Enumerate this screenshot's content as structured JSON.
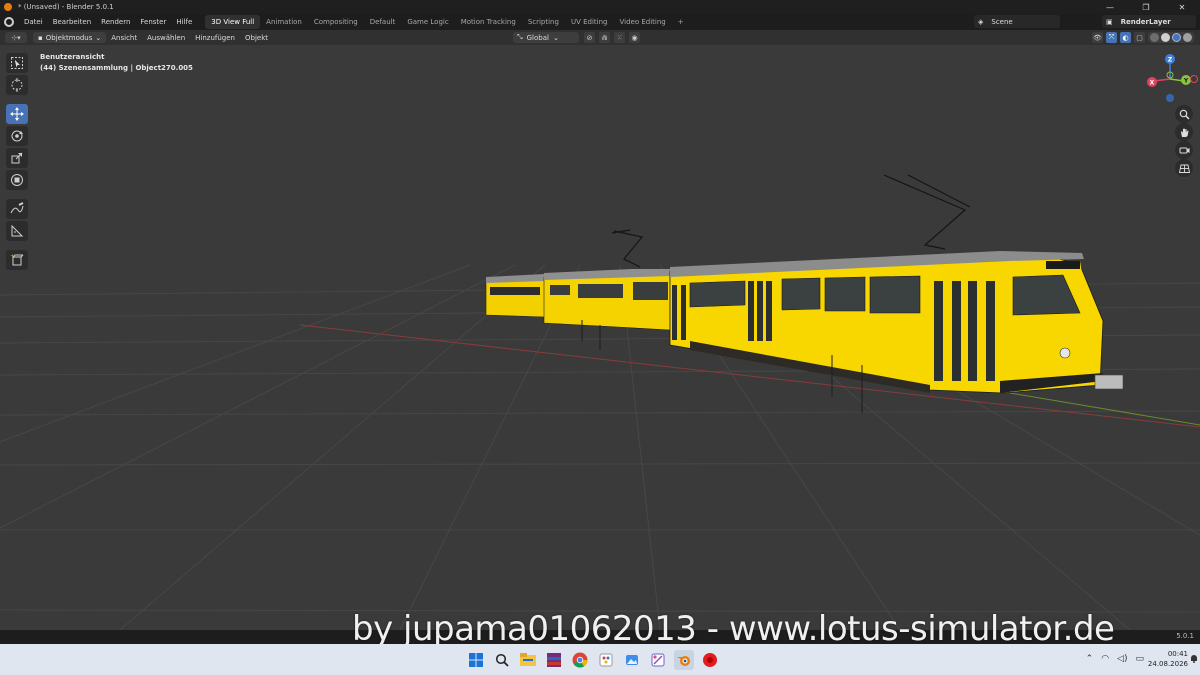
{
  "titlebar": {
    "title": "* (Unsaved) - Blender 5.0.1",
    "min": "—",
    "max": "❐",
    "close": "✕"
  },
  "menu": {
    "items": [
      "Datei",
      "Bearbeiten",
      "Rendern",
      "Fenster",
      "Hilfe"
    ]
  },
  "workspaces": {
    "tabs": [
      "3D View Full",
      "Animation",
      "Compositing",
      "Default",
      "Game Logic",
      "Motion Tracking",
      "Scripting",
      "UV Editing",
      "Video Editing"
    ],
    "active": "3D View Full",
    "add": "+"
  },
  "scene": {
    "label": "Scene"
  },
  "viewlayer": {
    "label": "RenderLayer"
  },
  "viewport_header": {
    "mode": "Objektmodus",
    "menus": [
      "Ansicht",
      "Auswählen",
      "Hinzufügen",
      "Objekt"
    ],
    "orientation": "Global"
  },
  "viewport": {
    "view_name": "Benutzeransicht",
    "collection_info": "(44) Szenensammlung | Object270.005"
  },
  "gizmo": {
    "axes": [
      "X",
      "Y",
      "Z"
    ],
    "colors": {
      "x": "#e0445c",
      "y": "#8ac43c",
      "z": "#3f7fd6",
      "neg": "#3666a8"
    }
  },
  "colors": {
    "accent": "#4772b3",
    "tram_yellow": "#f7d500",
    "viewport_bg": "#3a3a3a"
  },
  "status": {
    "version": "5.0.1"
  },
  "watermark": {
    "text": "by jupama01062013 - www.lotus-simulator.de"
  },
  "taskbar": {
    "time": "00:41",
    "date": "24.08.2026"
  }
}
